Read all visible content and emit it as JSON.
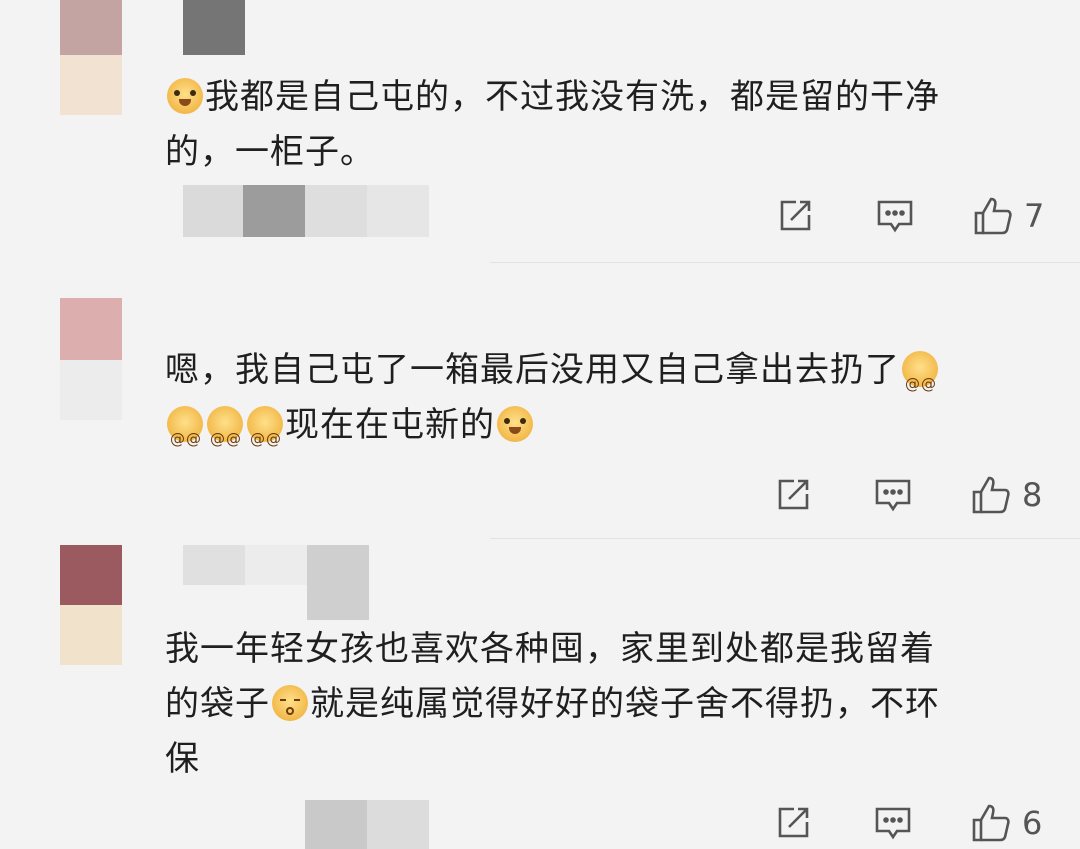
{
  "comments": [
    {
      "text_line1": "我都是自己屯的，不过我没有洗，都是留的干净",
      "text_line2": "的，一柜子。",
      "share_icon": "share-icon",
      "comment_icon": "comment-icon",
      "like_icon": "thumbs-up-icon",
      "likes": "7"
    },
    {
      "text_line1_a": "嗯，我自己屯了一箱最后没用又自己拿出去扔了",
      "text_line2_a": "现在在屯新的",
      "likes": "8"
    },
    {
      "text_line1": "我一年轻女孩也喜欢各种囤，家里到处都是我留着",
      "text_line2_a": "的袋子",
      "text_line2_b": "就是纯属觉得好好的袋子舍不得扔，不环",
      "text_line3": "保",
      "likes": "6"
    }
  ],
  "colors": {
    "background": "#f3f3f3",
    "text": "#1f1f1f",
    "icon": "#555555"
  }
}
